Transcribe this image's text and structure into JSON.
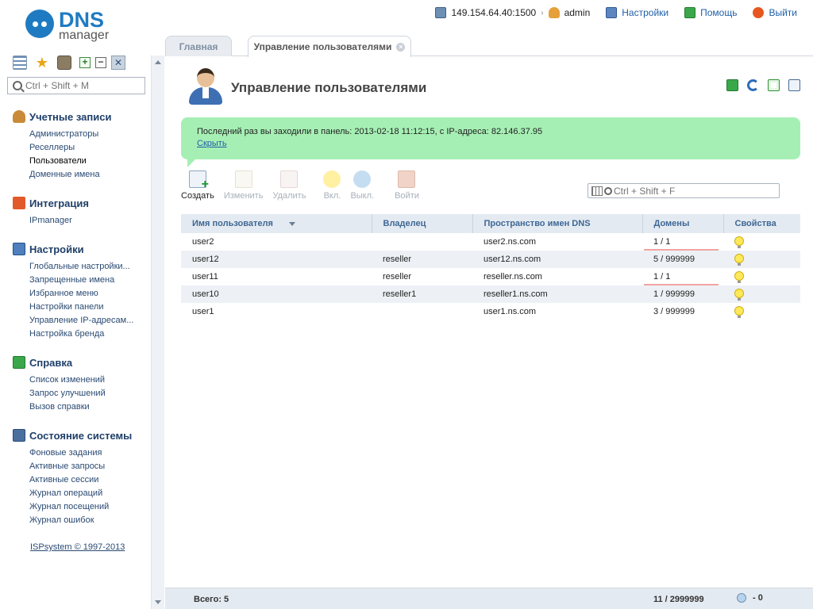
{
  "logo": {
    "dns": "DNS",
    "manager": "manager"
  },
  "topbar": {
    "server": "149.154.64.40:1500",
    "user": "admin",
    "settings": "Настройки",
    "help": "Помощь",
    "exit": "Выйти"
  },
  "sidebar": {
    "search_placeholder": "Ctrl + Shift + M",
    "sections": [
      {
        "title": "Учетные записи",
        "items": [
          "Администраторы",
          "Реселлеры",
          "Пользователи",
          "Доменные имена"
        ]
      },
      {
        "title": "Интеграция",
        "items": [
          "IPmanager"
        ]
      },
      {
        "title": "Настройки",
        "items": [
          "Глобальные настройки...",
          "Запрещенные имена",
          "Избранное меню",
          "Настройки панели",
          "Управление IP-адресам...",
          "Настройка бренда"
        ]
      },
      {
        "title": "Справка",
        "items": [
          "Список изменений",
          "Запрос улучшений",
          "Вызов справки"
        ]
      },
      {
        "title": "Состояние системы",
        "items": [
          "Фоновые задания",
          "Активные запросы",
          "Активные сессии",
          "Журнал операций",
          "Журнал посещений",
          "Журнал ошибок"
        ]
      }
    ],
    "footer": "ISPsystem © 1997-2013"
  },
  "tabs": {
    "home": "Главная",
    "users": "Управление пользователями"
  },
  "page": {
    "title": "Управление пользователями"
  },
  "notice": {
    "text": "Последний раз вы заходили в панель: 2013-02-18 11:12:15, с IP-адреса: 82.146.37.95",
    "hide": "Скрыть"
  },
  "toolbar": {
    "create": "Создать",
    "edit": "Изменить",
    "delete": "Удалить",
    "enable": "Вкл.",
    "disable": "Выкл.",
    "login": "Войти",
    "search_placeholder": "Ctrl + Shift + F"
  },
  "table": {
    "headers": {
      "name": "Имя пользователя",
      "owner": "Владелец",
      "ns": "Пространство имен DNS",
      "domains": "Домены",
      "props": "Свойства"
    },
    "rows": [
      {
        "name": "user2",
        "owner": "",
        "ns": "user2.ns.com",
        "domains": "1 / 1"
      },
      {
        "name": "user12",
        "owner": "reseller",
        "ns": "user12.ns.com",
        "domains": "5 / 999999"
      },
      {
        "name": "user11",
        "owner": "reseller",
        "ns": "reseller.ns.com",
        "domains": "1 / 1"
      },
      {
        "name": "user10",
        "owner": "reseller1",
        "ns": "reseller1.ns.com",
        "domains": "1 / 999999"
      },
      {
        "name": "user1",
        "owner": "",
        "ns": "user1.ns.com",
        "domains": "3 / 999999"
      }
    ]
  },
  "status": {
    "total": "Всего: 5",
    "domains": "11 / 2999999",
    "off_count": "- 0"
  }
}
